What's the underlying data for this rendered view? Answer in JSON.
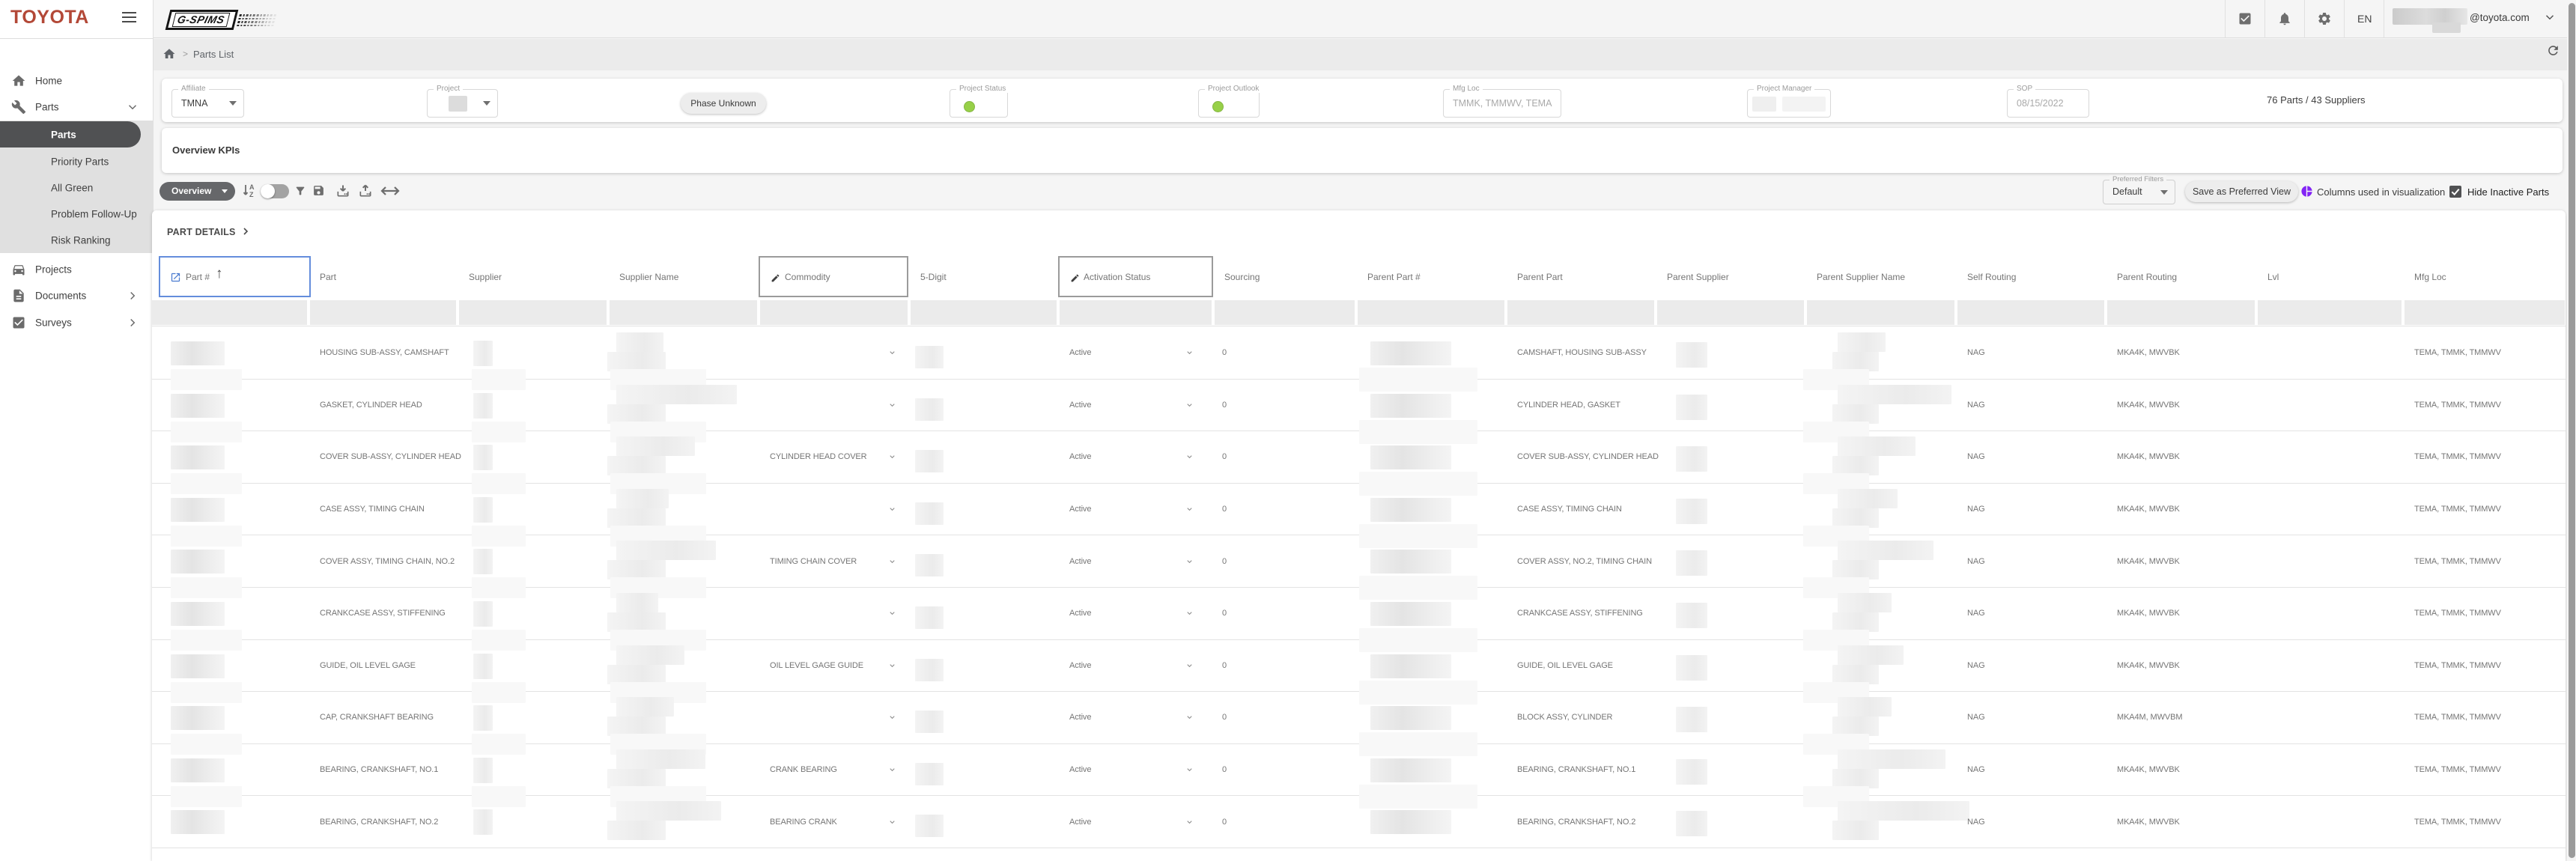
{
  "brand": {
    "company": "TOYOTA",
    "app_logo": "G-SPIMS"
  },
  "header": {
    "language": "EN",
    "user_email_domain": "@toyota.com"
  },
  "breadcrumb": {
    "page": "Parts List"
  },
  "sidebar": {
    "items": [
      {
        "label": "Home",
        "icon": "home",
        "type": "main"
      },
      {
        "label": "Parts",
        "icon": "tools",
        "type": "main",
        "chevron": "down",
        "expanded": true
      },
      {
        "label": "Parts",
        "type": "sub",
        "selected": true
      },
      {
        "label": "Priority Parts",
        "type": "sub"
      },
      {
        "label": "All Green",
        "type": "sub"
      },
      {
        "label": "Problem Follow-Up",
        "type": "sub"
      },
      {
        "label": "Risk Ranking",
        "type": "sub"
      },
      {
        "label": "Projects",
        "icon": "car",
        "type": "main"
      },
      {
        "label": "Documents",
        "icon": "document",
        "type": "main",
        "chevron": "right"
      },
      {
        "label": "Surveys",
        "icon": "survey",
        "type": "main",
        "chevron": "right"
      }
    ]
  },
  "filters": {
    "affiliate": {
      "label": "Affiliate",
      "value": "TMNA"
    },
    "project": {
      "label": "Project",
      "value": ""
    },
    "phase_button": "Phase Unknown",
    "project_status": {
      "label": "Project Status",
      "status_color": "#97d048"
    },
    "project_outlook": {
      "label": "Project Outlook",
      "status_color": "#97d048"
    },
    "mfg_loc": {
      "label": "Mfg Loc",
      "value": "TMMK, TMMWV, TEMA"
    },
    "project_manager": {
      "label": "Project Manager",
      "value": ""
    },
    "sop": {
      "label": "SOP",
      "value": "08/15/2022"
    },
    "summary": "76 Parts / 43 Suppliers"
  },
  "kpi": {
    "title": "Overview KPIs"
  },
  "toolbar": {
    "view_button": "Overview",
    "preferred_filters": {
      "label": "Preferred Filters",
      "value": "Default"
    },
    "save_view_button": "Save as Preferred View",
    "columns_viz_label": "Columns used in visualization",
    "columns_viz_color": "#8325f5",
    "hide_inactive_label": "Hide Inactive Parts",
    "hide_inactive_checked": true
  },
  "table": {
    "section_title": "PART DETAILS",
    "columns": [
      "Part #",
      "Part",
      "Supplier",
      "Supplier Name",
      "Commodity",
      "5-Digit",
      "Activation Status",
      "Sourcing",
      "Parent Part #",
      "Parent Part",
      "Parent Supplier",
      "Parent Supplier Name",
      "Self Routing",
      "Parent Routing",
      "Lvl",
      "Mfg Loc"
    ],
    "rows": [
      {
        "part": "HOUSING SUB-ASSY, CAMSHAFT",
        "commodity": "",
        "activation": "Active",
        "sourcing": "0",
        "parent_part": "CAMSHAFT, HOUSING SUB-ASSY",
        "self_routing": "NAG",
        "parent_routing": "MKA4K, MWVBK",
        "lvl": "",
        "mfg_loc": "TEMA, TMMK, TMMWV"
      },
      {
        "part": "GASKET, CYLINDER HEAD",
        "commodity": "",
        "activation": "Active",
        "sourcing": "0",
        "parent_part": "CYLINDER HEAD, GASKET",
        "self_routing": "NAG",
        "parent_routing": "MKA4K, MWVBK",
        "lvl": "",
        "mfg_loc": "TEMA, TMMK, TMMWV"
      },
      {
        "part": "COVER SUB-ASSY, CYLINDER HEAD",
        "commodity": "CYLINDER HEAD COVER",
        "activation": "Active",
        "sourcing": "0",
        "parent_part": "COVER SUB-ASSY, CYLINDER HEAD",
        "self_routing": "NAG",
        "parent_routing": "MKA4K, MWVBK",
        "lvl": "",
        "mfg_loc": "TEMA, TMMK, TMMWV"
      },
      {
        "part": "CASE ASSY, TIMING CHAIN",
        "commodity": "",
        "activation": "Active",
        "sourcing": "0",
        "parent_part": "CASE ASSY, TIMING CHAIN",
        "self_routing": "NAG",
        "parent_routing": "MKA4K, MWVBK",
        "lvl": "",
        "mfg_loc": "TEMA, TMMK, TMMWV"
      },
      {
        "part": "COVER ASSY, TIMING CHAIN, NO.2",
        "commodity": "TIMING CHAIN COVER",
        "activation": "Active",
        "sourcing": "0",
        "parent_part": "COVER ASSY, NO.2, TIMING CHAIN",
        "self_routing": "NAG",
        "parent_routing": "MKA4K, MWVBK",
        "lvl": "",
        "mfg_loc": "TEMA, TMMK, TMMWV"
      },
      {
        "part": "CRANKCASE ASSY, STIFFENING",
        "commodity": "",
        "activation": "Active",
        "sourcing": "0",
        "parent_part": "CRANKCASE ASSY, STIFFENING",
        "self_routing": "NAG",
        "parent_routing": "MKA4K, MWVBK",
        "lvl": "",
        "mfg_loc": "TEMA, TMMK, TMMWV"
      },
      {
        "part": "GUIDE, OIL LEVEL GAGE",
        "commodity": "OIL LEVEL GAGE GUIDE",
        "activation": "Active",
        "sourcing": "0",
        "parent_part": "GUIDE, OIL LEVEL GAGE",
        "self_routing": "NAG",
        "parent_routing": "MKA4K, MWVBK",
        "lvl": "",
        "mfg_loc": "TEMA, TMMK, TMMWV"
      },
      {
        "part": "CAP, CRANKSHAFT BEARING",
        "commodity": "",
        "activation": "Active",
        "sourcing": "0",
        "parent_part": "BLOCK ASSY, CYLINDER",
        "self_routing": "NAG",
        "parent_routing": "MKA4M, MWVBM",
        "lvl": "",
        "mfg_loc": "TEMA, TMMK, TMMWV"
      },
      {
        "part": "BEARING, CRANKSHAFT, NO.1",
        "commodity": "CRANK BEARING",
        "activation": "Active",
        "sourcing": "0",
        "parent_part": "BEARING, CRANKSHAFT, NO.1",
        "self_routing": "NAG",
        "parent_routing": "MKA4K, MWVBK",
        "lvl": "",
        "mfg_loc": "TEMA, TMMK, TMMWV"
      },
      {
        "part": "BEARING, CRANKSHAFT, NO.2",
        "commodity": "BEARING CRANK",
        "activation": "Active",
        "sourcing": "0",
        "parent_part": "BEARING, CRANKSHAFT, NO.2",
        "self_routing": "NAG",
        "parent_routing": "MKA4K, MWVBK",
        "lvl": "",
        "mfg_loc": "TEMA, TMMK, TMMWV"
      }
    ]
  }
}
